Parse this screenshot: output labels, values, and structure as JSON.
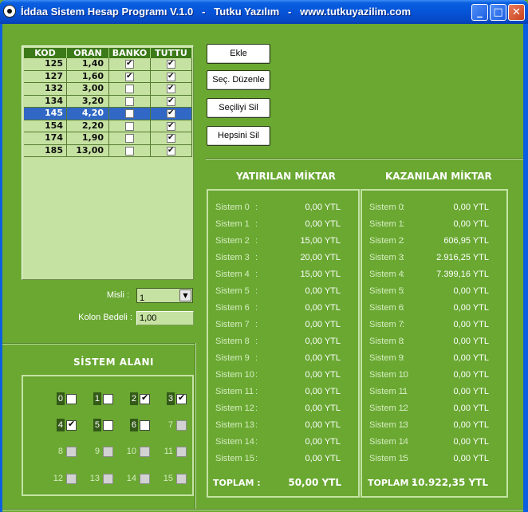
{
  "window": {
    "title": "İddaa Sistem Hesap Programı V.1.0   -   Tutku Yazılım   -   www.tutkuyazilim.com",
    "minimize": "_",
    "maximize": "□",
    "close": "✕"
  },
  "list": {
    "headers": [
      "KOD",
      "ORAN",
      "BANKO",
      "TUTTU"
    ],
    "rows": [
      {
        "kod": "125",
        "oran": "1,40",
        "banko": true,
        "tuttu": true
      },
      {
        "kod": "127",
        "oran": "1,60",
        "banko": true,
        "tuttu": true
      },
      {
        "kod": "132",
        "oran": "3,00",
        "banko": false,
        "tuttu": true
      },
      {
        "kod": "134",
        "oran": "3,20",
        "banko": false,
        "tuttu": true
      },
      {
        "kod": "145",
        "oran": "4,20",
        "banko": false,
        "tuttu": true,
        "selected": true
      },
      {
        "kod": "154",
        "oran": "2,20",
        "banko": false,
        "tuttu": true
      },
      {
        "kod": "174",
        "oran": "1,90",
        "banko": false,
        "tuttu": true
      },
      {
        "kod": "185",
        "oran": "13,00",
        "banko": false,
        "tuttu": true
      }
    ]
  },
  "buttons": {
    "ekle": "Ekle",
    "sec_duzenle": "Seç. Düzenle",
    "secili_sil": "Seçiliyi Sil",
    "hepsini_sil": "Hepsini Sil"
  },
  "misli": {
    "label": "Misli :",
    "value": "1"
  },
  "kolon_bedeli": {
    "label": "Kolon Bedeli :",
    "value": "1,00"
  },
  "sistem_alani": {
    "title": "SİSTEM ALANI",
    "items": [
      {
        "n": "0",
        "enabled": true,
        "checked": false
      },
      {
        "n": "1",
        "enabled": true,
        "checked": false
      },
      {
        "n": "2",
        "enabled": true,
        "checked": true
      },
      {
        "n": "3",
        "enabled": true,
        "checked": true
      },
      {
        "n": "4",
        "enabled": true,
        "checked": true
      },
      {
        "n": "5",
        "enabled": true,
        "checked": false
      },
      {
        "n": "6",
        "enabled": true,
        "checked": false
      },
      {
        "n": "7",
        "enabled": false,
        "checked": false
      },
      {
        "n": "8",
        "enabled": false,
        "checked": false
      },
      {
        "n": "9",
        "enabled": false,
        "checked": false
      },
      {
        "n": "10",
        "enabled": false,
        "checked": false
      },
      {
        "n": "11",
        "enabled": false,
        "checked": false
      },
      {
        "n": "12",
        "enabled": false,
        "checked": false
      },
      {
        "n": "13",
        "enabled": false,
        "checked": false
      },
      {
        "n": "14",
        "enabled": false,
        "checked": false
      },
      {
        "n": "15",
        "enabled": false,
        "checked": false
      }
    ]
  },
  "yatirilan": {
    "title": "YATIRILAN MİKTAR",
    "rows": [
      {
        "name": "Sistem 0",
        "sep": ":",
        "value": "0,00 YTL"
      },
      {
        "name": "Sistem 1",
        "sep": ":",
        "value": "0,00 YTL"
      },
      {
        "name": "Sistem 2",
        "sep": ":",
        "value": "15,00 YTL"
      },
      {
        "name": "Sistem 3",
        "sep": ":",
        "value": "20,00 YTL"
      },
      {
        "name": "Sistem 4",
        "sep": ":",
        "value": "15,00 YTL"
      },
      {
        "name": "Sistem 5",
        "sep": ":",
        "value": "0,00 YTL"
      },
      {
        "name": "Sistem 6",
        "sep": ":",
        "value": "0,00 YTL"
      },
      {
        "name": "Sistem 7",
        "sep": ":",
        "value": "0,00 YTL"
      },
      {
        "name": "Sistem 8",
        "sep": ":",
        "value": "0,00 YTL"
      },
      {
        "name": "Sistem 9",
        "sep": ":",
        "value": "0,00 YTL"
      },
      {
        "name": "Sistem 10",
        "sep": ":",
        "value": "0,00 YTL"
      },
      {
        "name": "Sistem 11",
        "sep": ":",
        "value": "0,00 YTL"
      },
      {
        "name": "Sistem 12",
        "sep": ":",
        "value": "0,00 YTL"
      },
      {
        "name": "Sistem 13",
        "sep": ":",
        "value": "0,00 YTL"
      },
      {
        "name": "Sistem 14",
        "sep": ":",
        "value": "0,00 YTL"
      },
      {
        "name": "Sistem 15",
        "sep": ":",
        "value": "0,00 YTL"
      }
    ],
    "total_label": "TOPLAM :",
    "total_value": "50,00 YTL"
  },
  "kazanilan": {
    "title": "KAZANILAN MİKTAR",
    "rows": [
      {
        "name": "Sistem 0",
        "sep": ":",
        "value": "0,00 YTL"
      },
      {
        "name": "Sistem 1",
        "sep": ":",
        "value": "0,00 YTL"
      },
      {
        "name": "Sistem 2",
        "sep": ":",
        "value": "606,95 YTL"
      },
      {
        "name": "Sistem 3",
        "sep": ":",
        "value": "2.916,25 YTL"
      },
      {
        "name": "Sistem 4",
        "sep": ":",
        "value": "7.399,16 YTL"
      },
      {
        "name": "Sistem 5",
        "sep": ":",
        "value": "0,00 YTL"
      },
      {
        "name": "Sistem 6",
        "sep": ":",
        "value": "0,00 YTL"
      },
      {
        "name": "Sistem 7",
        "sep": ":",
        "value": "0,00 YTL"
      },
      {
        "name": "Sistem 8",
        "sep": ":",
        "value": "0,00 YTL"
      },
      {
        "name": "Sistem 9",
        "sep": ":",
        "value": "0,00 YTL"
      },
      {
        "name": "Sistem 10",
        "sep": ":",
        "value": "0,00 YTL"
      },
      {
        "name": "Sistem 11",
        "sep": ":",
        "value": "0,00 YTL"
      },
      {
        "name": "Sistem 12",
        "sep": ":",
        "value": "0,00 YTL"
      },
      {
        "name": "Sistem 13",
        "sep": ":",
        "value": "0,00 YTL"
      },
      {
        "name": "Sistem 14",
        "sep": ":",
        "value": "0,00 YTL"
      },
      {
        "name": "Sistem 15",
        "sep": ":",
        "value": "0,00 YTL"
      }
    ],
    "total_label": "TOPLAM :",
    "total_value": "10.922,35 YTL"
  }
}
